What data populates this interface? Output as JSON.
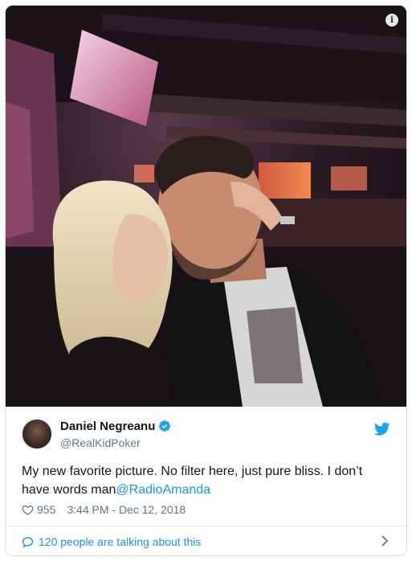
{
  "tweet": {
    "author_name": "Daniel Negreanu",
    "author_handle": "@RealKidPoker",
    "text_before": "My new favorite picture. No filter here, just pure bliss. I don’t have words man",
    "mention": "@RadioAmanda",
    "likes": "955",
    "timestamp": "3:44 PM - Dec 12, 2018",
    "talking_label": "120 people are talking about this",
    "info_glyph": "i"
  },
  "icons": {
    "info": "info-icon",
    "verified": "verified-badge-icon",
    "bird": "twitter-bird-icon",
    "heart": "heart-icon",
    "bubble": "speech-bubble-icon",
    "chevron": "chevron-right-icon"
  },
  "colors": {
    "link": "#1b95e0",
    "text": "#14171a",
    "muted": "#657786",
    "border": "#e1e8ed"
  }
}
